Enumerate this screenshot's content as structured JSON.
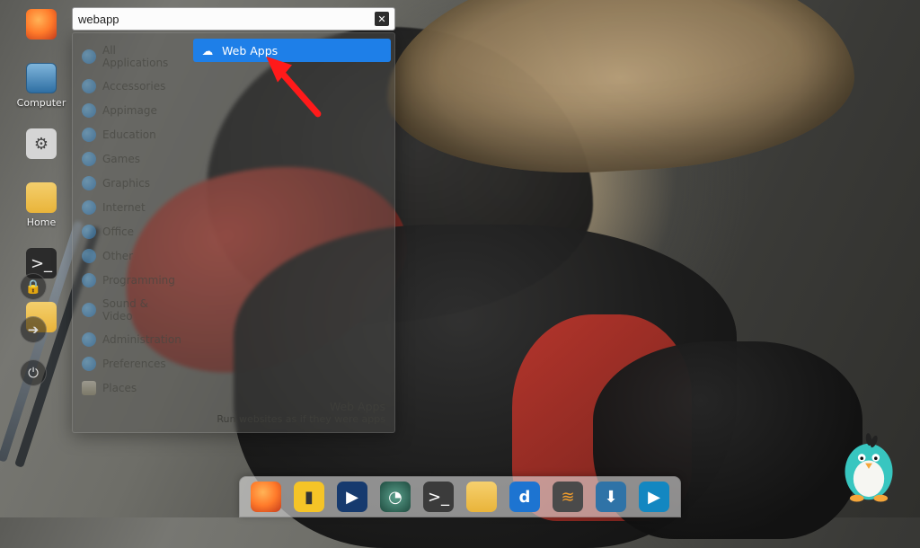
{
  "desktop": {
    "icons": [
      {
        "id": "firefox",
        "label": "",
        "color": "#ff7a2a"
      },
      {
        "id": "computer",
        "label": "Computer",
        "color": "#2f6fa3"
      },
      {
        "id": "settings",
        "label": "",
        "color": "#5e5e5e"
      },
      {
        "id": "home",
        "label": "Home",
        "color": "#e9b43a"
      },
      {
        "id": "terminal",
        "label": "",
        "color": "#2b2b2b"
      },
      {
        "id": "folder",
        "label": "",
        "color": "#e9b43a"
      }
    ]
  },
  "side_buttons": [
    "lock",
    "arrow",
    "power"
  ],
  "menu": {
    "search_value": "webapp",
    "categories": [
      "All Applications",
      "Accessories",
      "Appimage",
      "Education",
      "Games",
      "Graphics",
      "Internet",
      "Office",
      "Other",
      "Programming",
      "Sound & Video",
      "Administration",
      "Preferences",
      "Places"
    ],
    "result": {
      "label": "Web Apps"
    },
    "footer_title": "Web Apps",
    "footer_desc": "Run websites as if they were apps"
  },
  "dock": [
    {
      "id": "firefox",
      "color": "#ff7a2a"
    },
    {
      "id": "notes",
      "color": "#f5c427"
    },
    {
      "id": "video",
      "color": "#163a6e"
    },
    {
      "id": "disk",
      "color": "#2e5f52"
    },
    {
      "id": "terminal",
      "color": "#3b3b3b"
    },
    {
      "id": "files",
      "color": "#f0bf3e"
    },
    {
      "id": "d-app",
      "color": "#1d74d1"
    },
    {
      "id": "sublime",
      "color": "#4a4a4a"
    },
    {
      "id": "updater",
      "color": "#2f73a7"
    },
    {
      "id": "player",
      "color": "#1387c1"
    }
  ],
  "colors": {
    "accent": "#1e7fe8",
    "arrow": "#ff1a1a"
  }
}
